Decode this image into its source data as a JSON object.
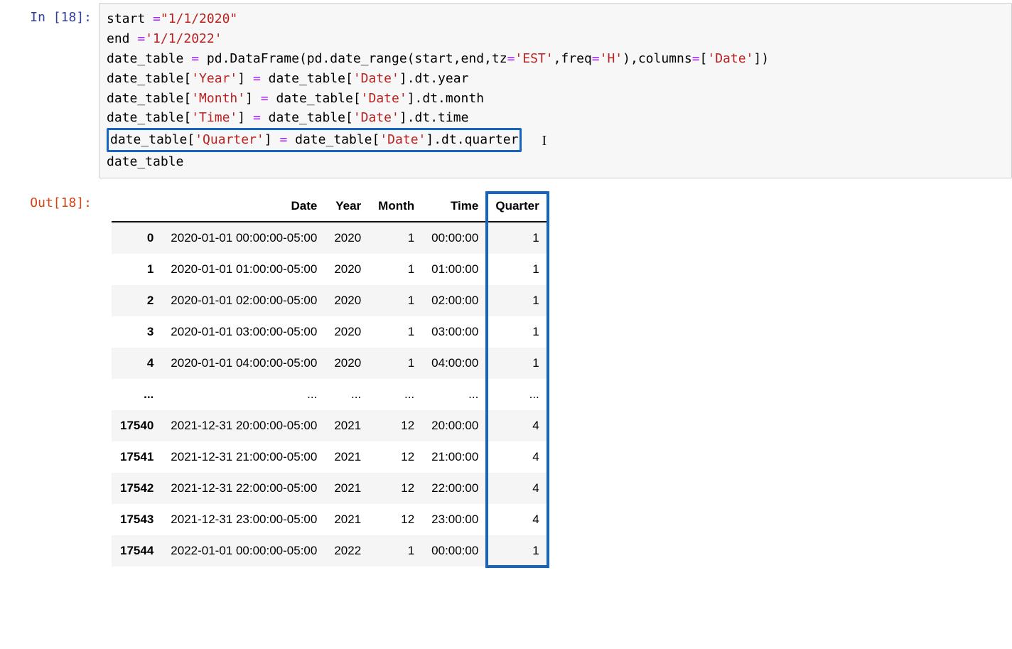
{
  "cell": {
    "in_prompt": "In [18]:",
    "out_prompt": "Out[18]:",
    "code": {
      "l1": {
        "a": "start ",
        "op1": "=",
        "s": "\"1/1/2020\""
      },
      "l2": {
        "a": "end ",
        "op1": "=",
        "s": "'1/1/2022'"
      },
      "l3": {
        "a": "date_table ",
        "op1": "=",
        "b": " pd",
        "c": ".DataFrame(pd",
        "d": ".date_range(start,end,tz",
        "op2": "=",
        "s1": "'EST'",
        "e": ",freq",
        "op3": "=",
        "s2": "'H'",
        "f": "),columns",
        "op4": "=",
        "g": "[",
        "s3": "'Date'",
        "h": "])"
      },
      "l4": {
        "a": "date_table[",
        "s1": "'Year'",
        "b": "] ",
        "op1": "=",
        "c": " date_table[",
        "s2": "'Date'",
        "d": "]",
        "e": ".dt",
        "f": ".year"
      },
      "l5": {
        "a": "date_table[",
        "s1": "'Month'",
        "b": "] ",
        "op1": "=",
        "c": " date_table[",
        "s2": "'Date'",
        "d": "]",
        "e": ".dt",
        "f": ".month"
      },
      "l6": {
        "a": "date_table[",
        "s1": "'Time'",
        "b": "] ",
        "op1": "=",
        "c": " date_table[",
        "s2": "'Date'",
        "d": "]",
        "e": ".dt",
        "f": ".time"
      },
      "l7": {
        "a": "date_table[",
        "s1": "'Quarter'",
        "b": "] ",
        "op1": "=",
        "c": " date_table[",
        "s2": "'Date'",
        "d": "]",
        "e": ".dt",
        "f": ".quarter"
      },
      "l8": {
        "a": "date_table"
      }
    }
  },
  "table": {
    "headers": [
      "",
      "Date",
      "Year",
      "Month",
      "Time",
      "Quarter"
    ],
    "rows": [
      {
        "idx": "0",
        "date": "2020-01-01 00:00:00-05:00",
        "year": "2020",
        "month": "1",
        "time": "00:00:00",
        "quarter": "1"
      },
      {
        "idx": "1",
        "date": "2020-01-01 01:00:00-05:00",
        "year": "2020",
        "month": "1",
        "time": "01:00:00",
        "quarter": "1"
      },
      {
        "idx": "2",
        "date": "2020-01-01 02:00:00-05:00",
        "year": "2020",
        "month": "1",
        "time": "02:00:00",
        "quarter": "1"
      },
      {
        "idx": "3",
        "date": "2020-01-01 03:00:00-05:00",
        "year": "2020",
        "month": "1",
        "time": "03:00:00",
        "quarter": "1"
      },
      {
        "idx": "4",
        "date": "2020-01-01 04:00:00-05:00",
        "year": "2020",
        "month": "1",
        "time": "04:00:00",
        "quarter": "1"
      },
      {
        "idx": "...",
        "date": "...",
        "year": "...",
        "month": "...",
        "time": "...",
        "quarter": "..."
      },
      {
        "idx": "17540",
        "date": "2021-12-31 20:00:00-05:00",
        "year": "2021",
        "month": "12",
        "time": "20:00:00",
        "quarter": "4"
      },
      {
        "idx": "17541",
        "date": "2021-12-31 21:00:00-05:00",
        "year": "2021",
        "month": "12",
        "time": "21:00:00",
        "quarter": "4"
      },
      {
        "idx": "17542",
        "date": "2021-12-31 22:00:00-05:00",
        "year": "2021",
        "month": "12",
        "time": "22:00:00",
        "quarter": "4"
      },
      {
        "idx": "17543",
        "date": "2021-12-31 23:00:00-05:00",
        "year": "2021",
        "month": "12",
        "time": "23:00:00",
        "quarter": "4"
      },
      {
        "idx": "17544",
        "date": "2022-01-01 00:00:00-05:00",
        "year": "2022",
        "month": "1",
        "time": "00:00:00",
        "quarter": "1"
      }
    ]
  }
}
